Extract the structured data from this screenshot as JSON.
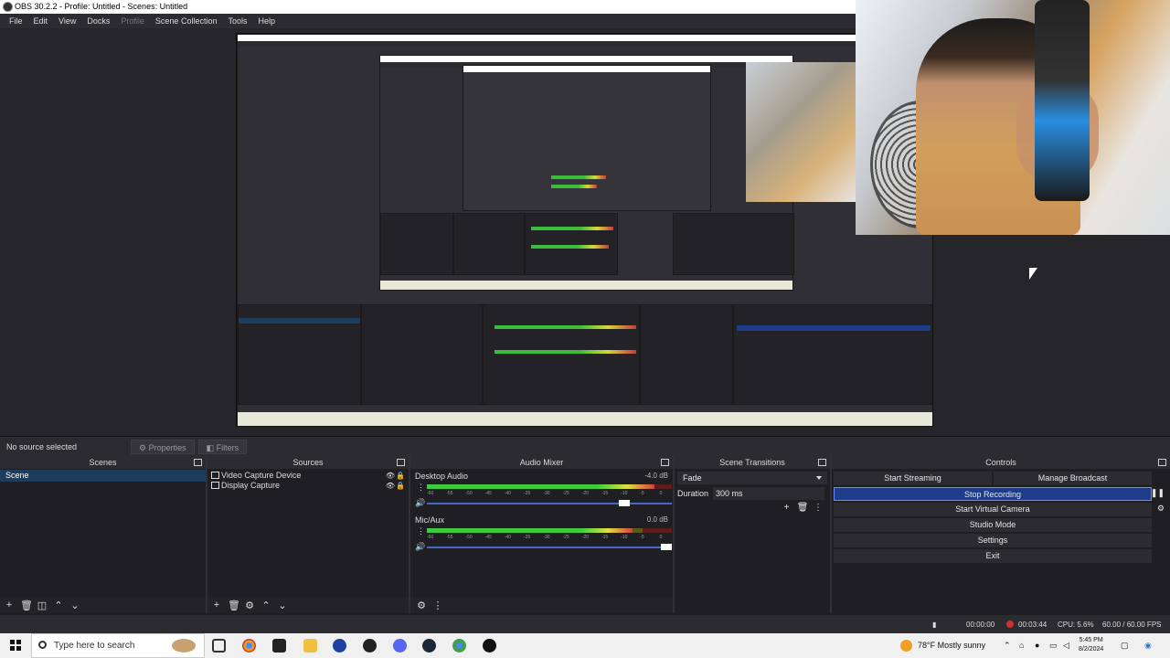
{
  "window": {
    "title": "OBS 30.2.2 - Profile: Untitled - Scenes: Untitled"
  },
  "menu": [
    "File",
    "Edit",
    "View",
    "Docks",
    "Profile",
    "Scene Collection",
    "Tools",
    "Help"
  ],
  "source_bar": {
    "no_source": "No source selected",
    "properties": "Properties",
    "filters": "Filters"
  },
  "scenes": {
    "title": "Scenes",
    "items": [
      "Scene"
    ]
  },
  "sources": {
    "title": "Sources",
    "items": [
      "Video Capture Device",
      "Display Capture"
    ]
  },
  "mixer": {
    "title": "Audio Mixer",
    "channels": [
      {
        "name": "Desktop Audio",
        "db": "-4.0 dB",
        "level": 0.93,
        "volume": 0.83
      },
      {
        "name": "Mic/Aux",
        "db": "0.0 dB",
        "level": 0.84,
        "volume": 1.0
      }
    ],
    "ticks": [
      "-60",
      "-55",
      "-50",
      "-45",
      "-40",
      "-35",
      "-30",
      "-25",
      "-20",
      "-15",
      "-10",
      "-5",
      "0"
    ]
  },
  "transitions": {
    "title": "Scene Transitions",
    "selected": "Fade",
    "duration_label": "Duration",
    "duration_value": "300 ms"
  },
  "controls": {
    "title": "Controls",
    "start_streaming": "Start Streaming",
    "manage_broadcast": "Manage Broadcast",
    "stop_recording": "Stop Recording",
    "start_virtual_camera": "Start Virtual Camera",
    "studio_mode": "Studio Mode",
    "settings": "Settings",
    "exit": "Exit"
  },
  "status": {
    "stream_time": "00:00:00",
    "rec_time": "00:03:44",
    "cpu": "CPU: 5.6%",
    "fps": "60.00 / 60.00 FPS"
  },
  "taskbar": {
    "search_placeholder": "Type here to search",
    "weather": "78°F  Mostly sunny",
    "time": "5:45 PM",
    "date": "8/2/2024"
  },
  "colors": {
    "accent": "#1e3c8a",
    "selection": "#1e3c5b",
    "rec": "#d03030"
  }
}
